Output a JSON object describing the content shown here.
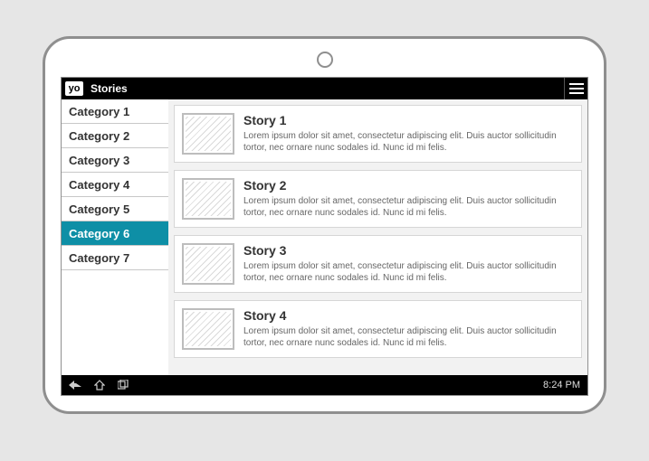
{
  "topbar": {
    "logo_text": "yo",
    "title": "Stories"
  },
  "sidebar": {
    "selected_index": 5,
    "items": [
      {
        "label": "Category 1"
      },
      {
        "label": "Category 2"
      },
      {
        "label": "Category 3"
      },
      {
        "label": "Category 4"
      },
      {
        "label": "Category 5"
      },
      {
        "label": "Category 6"
      },
      {
        "label": "Category 7"
      }
    ]
  },
  "stories": [
    {
      "title": "Story 1",
      "desc": "Lorem ipsum dolor sit amet, consectetur adipiscing elit. Duis auctor sollicitudin tortor, nec ornare nunc sodales id. Nunc id mi felis."
    },
    {
      "title": "Story 2",
      "desc": "Lorem ipsum dolor sit amet, consectetur adipiscing elit. Duis auctor sollicitudin tortor, nec ornare nunc sodales id. Nunc id mi felis."
    },
    {
      "title": "Story 3",
      "desc": "Lorem ipsum dolor sit amet, consectetur adipiscing elit. Duis auctor sollicitudin tortor, nec ornare nunc sodales id. Nunc id mi felis."
    },
    {
      "title": "Story 4",
      "desc": "Lorem ipsum dolor sit amet, consectetur adipiscing elit. Duis auctor sollicitudin tortor, nec ornare nunc sodales id. Nunc id mi felis."
    }
  ],
  "statusbar": {
    "time": "8:24 PM"
  }
}
